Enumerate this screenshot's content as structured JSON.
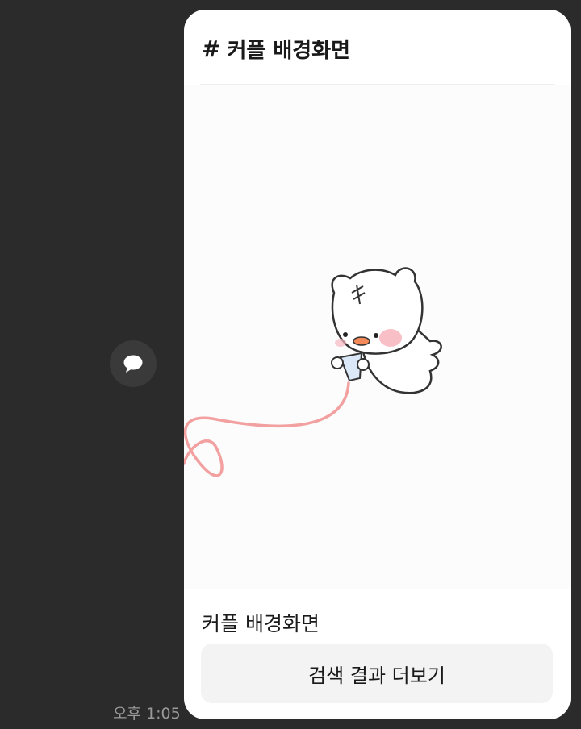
{
  "card": {
    "hash_symbol": "#",
    "title": "커플 배경화면",
    "caption": "커플 배경화면",
    "more_button_label": "검색 결과 더보기"
  },
  "message": {
    "timestamp": "오후 1:05"
  },
  "icons": {
    "share": "chat-bubble-icon"
  },
  "colors": {
    "background": "#2b2b2b",
    "card": "#ffffff",
    "button": "#f3f3f3",
    "string": "#f2a0a0",
    "blush": "#f7b8c0"
  }
}
